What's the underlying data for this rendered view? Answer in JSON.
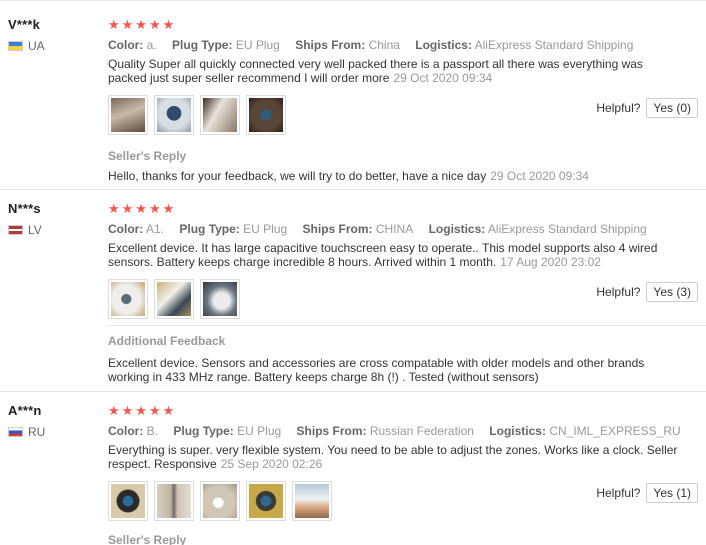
{
  "reviews": [
    {
      "user": "V***k",
      "country_code": "UA",
      "stars": "★★★★★",
      "color_label": "Color:",
      "color": "a.",
      "plug_label": "Plug Type:",
      "plug": "EU Plug",
      "ships_label": "Ships From:",
      "ships": "China",
      "logistics_label": "Logistics:",
      "logistics": "AliExpress Standard Shipping",
      "text": "Quality Super all quickly connected very well packed there is a passport all there was everything was packed just super seller recommend I will order more",
      "date": "29 Oct 2020 09:34",
      "helpful_label": "Helpful?",
      "helpful_button": "Yes (0)",
      "reply_title": "Seller's Reply",
      "reply_text": "Hello, thanks for your feedback, we will try to do better, have a nice day",
      "reply_date": "29 Oct 2020 09:34"
    },
    {
      "user": "N***s",
      "country_code": "LV",
      "stars": "★★★★★",
      "color_label": "Color:",
      "color": "A1.",
      "plug_label": "Plug Type:",
      "plug": "EU Plug",
      "ships_label": "Ships From:",
      "ships": "CHINA",
      "logistics_label": "Logistics:",
      "logistics": "AliExpress Standard Shipping",
      "text": "Excellent device. It has large capacitive touchscreen easy to operate.. This model supports also 4 wired sensors. Battery keeps charge incredible 8 hours. Arrived within 1 month.",
      "date": "17 Aug 2020 23:02",
      "helpful_label": "Helpful?",
      "helpful_button": "Yes (3)",
      "reply_title": "Additional Feedback",
      "reply_text": "Excellent device. Sensors and accessories are cross compatable with older models and other brands working in 433 MHz range. Battery keeps charge 8h (!) . Tested (without sensors)"
    },
    {
      "user": "A***n",
      "country_code": "RU",
      "stars": "★★★★★",
      "color_label": "Color:",
      "color": "B.",
      "plug_label": "Plug Type:",
      "plug": "EU Plug",
      "ships_label": "Ships From:",
      "ships": "Russian Federation",
      "logistics_label": "Logistics:",
      "logistics": "CN_IML_EXPRESS_RU",
      "text": "Everything is super. very flexible system. You need to be able to adjust the zones. Works like a clock. Seller respect. Responsive",
      "date": "25 Sep 2020 02:26",
      "helpful_label": "Helpful?",
      "helpful_button": "Yes (1)",
      "reply_title": "Seller's Reply"
    }
  ],
  "colors": {
    "star": "#f5554a",
    "meta_label": "#666666",
    "meta_value": "#999999",
    "border": "#e8e8e8"
  }
}
